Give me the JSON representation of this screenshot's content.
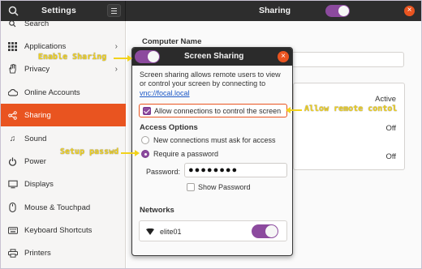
{
  "app": {
    "left_title": "Settings",
    "right_title": "Sharing"
  },
  "sidebar": {
    "items": [
      {
        "label": "Search",
        "icon": "search-icon"
      },
      {
        "label": "Applications",
        "icon": "apps-icon",
        "chevron": "›"
      },
      {
        "label": "Privacy",
        "icon": "hand-icon",
        "chevron": "›"
      },
      {
        "label": "Online Accounts",
        "icon": "online-accounts-icon"
      },
      {
        "label": "Sharing",
        "icon": "share-icon",
        "active": true
      },
      {
        "label": "Sound",
        "icon": "music-note-icon"
      },
      {
        "label": "Power",
        "icon": "power-icon"
      },
      {
        "label": "Displays",
        "icon": "display-icon"
      },
      {
        "label": "Mouse & Touchpad",
        "icon": "mouse-icon"
      },
      {
        "label": "Keyboard Shortcuts",
        "icon": "keyboard-icon"
      },
      {
        "label": "Printers",
        "icon": "printer-icon"
      }
    ]
  },
  "main": {
    "computer_name_label": "Computer Name",
    "rows": [
      {
        "status": "Active"
      },
      {
        "status": "Off"
      },
      {
        "status": "Off"
      }
    ]
  },
  "dialog": {
    "title": "Screen Sharing",
    "close_glyph": "×",
    "enabled": true,
    "description": "Screen sharing allows remote users to view or control your screen by connecting to",
    "link": "vnc://focal.local",
    "allow_control_label": "Allow connections to control the screen",
    "allow_control_checked": true,
    "access_options_label": "Access Options",
    "options": [
      {
        "label": "New connections must ask for access",
        "selected": false
      },
      {
        "label": "Require a password",
        "selected": true
      }
    ],
    "password_label": "Password:",
    "password_value": "●●●●●●●●",
    "show_password_label": "Show Password",
    "show_password_checked": false,
    "networks_label": "Networks",
    "network": {
      "name": "elite01",
      "enabled": true,
      "icon": "wifi-icon"
    }
  },
  "annotations": {
    "enable_sharing": "Enable Sharing",
    "allow_remote": "Allow remote contol",
    "setup_password": "Setup passwd"
  },
  "colors": {
    "accent": "#e95420",
    "toggle": "#8c4a9e",
    "annotation": "#f2d21b",
    "link": "#1a57c6"
  }
}
